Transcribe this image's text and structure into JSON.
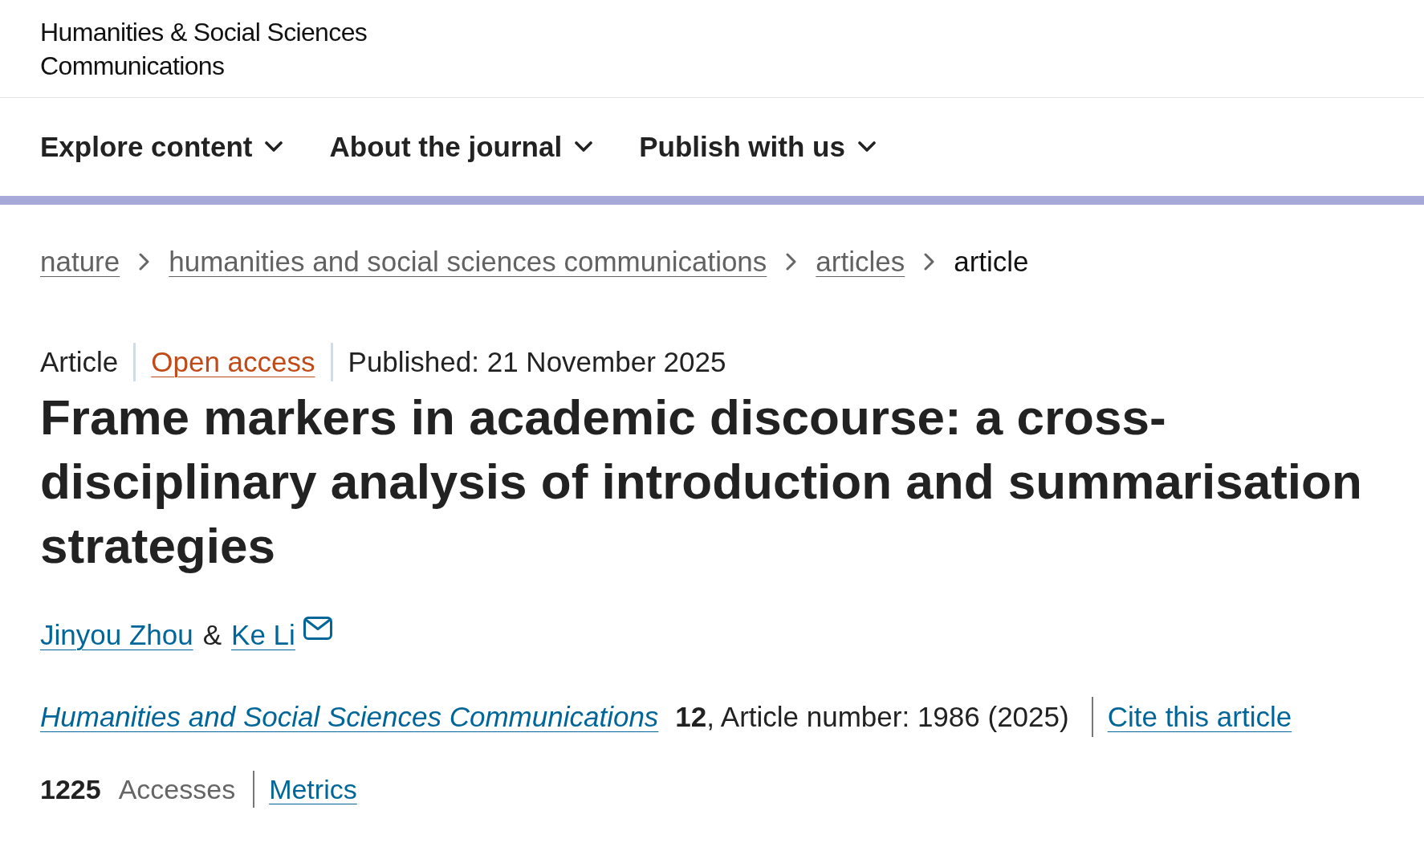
{
  "header": {
    "journal_name_lines": [
      "Humanities & Social Sciences",
      "Communications"
    ]
  },
  "nav": {
    "items": [
      {
        "label": "Explore content",
        "expanded": false
      },
      {
        "label": "About the journal",
        "expanded": false
      },
      {
        "label": "Publish with us",
        "expanded": false
      }
    ]
  },
  "breadcrumb": [
    {
      "label": "nature",
      "kind": "link"
    },
    {
      "label": "humanities and social sciences communications",
      "kind": "link"
    },
    {
      "label": "articles",
      "kind": "link"
    },
    {
      "label": "article",
      "kind": "current"
    }
  ],
  "article": {
    "type": "Article",
    "access": "Open access",
    "published": "Published: 21 November 2025",
    "title": "Frame markers in academic discourse: a cross-disciplinary analysis of introduction and summarisation strategies",
    "authors": [
      {
        "name": "Jinyou Zhou",
        "corresponding": false
      },
      {
        "name": "Ke Li",
        "corresponding": true
      }
    ],
    "author_separator": "&",
    "citation": {
      "journal": "Humanities and Social Sciences Communications",
      "details": "**12**, Article number: 1986 (2025)",
      "cite_link": "Cite this article"
    },
    "metrics": {
      "count": "1225",
      "label": "Accesses",
      "link": "Metrics"
    }
  }
}
